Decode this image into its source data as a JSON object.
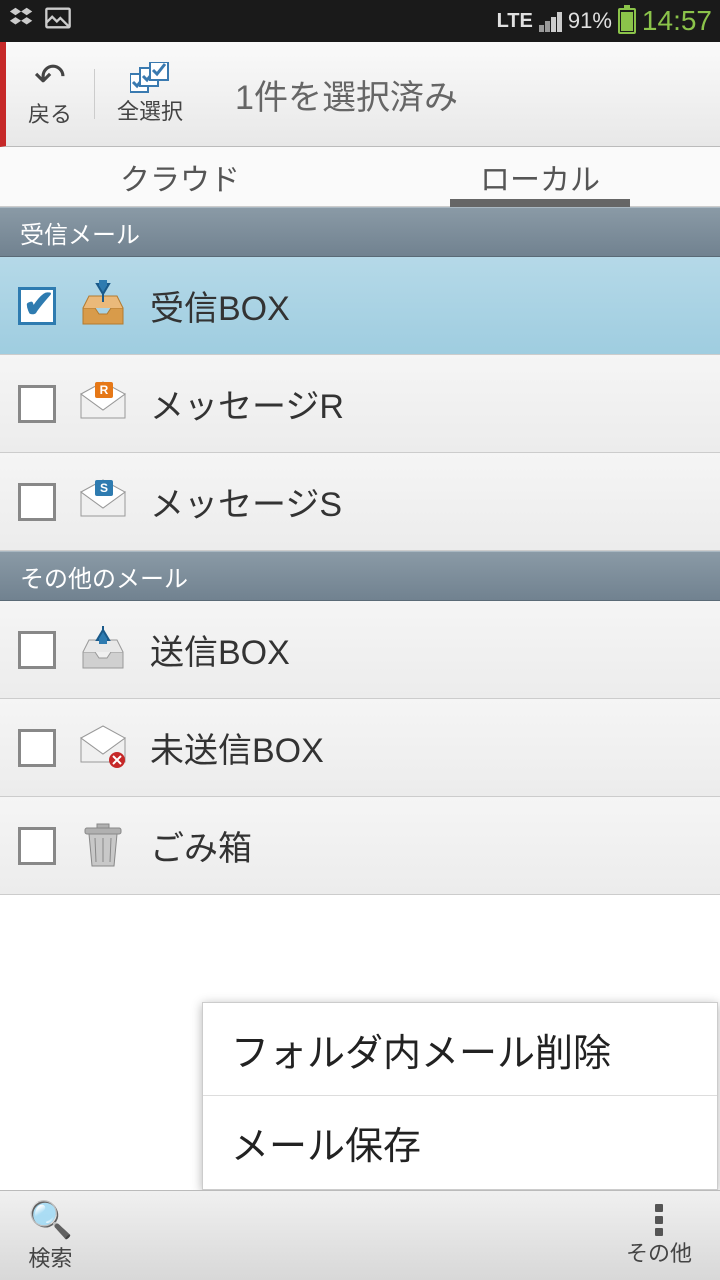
{
  "status": {
    "network": "LTE",
    "battery_pct": "91%",
    "time": "14:57"
  },
  "action_bar": {
    "back_label": "戻る",
    "select_all_label": "全選択",
    "title": "1件を選択済み"
  },
  "tabs": {
    "cloud": "クラウド",
    "local": "ローカル"
  },
  "sections": [
    {
      "header": "受信メール",
      "folders": [
        {
          "label": "受信BOX",
          "checked": true,
          "icon": "inbox-icon"
        },
        {
          "label": "メッセージR",
          "checked": false,
          "icon": "message-r-icon"
        },
        {
          "label": "メッセージS",
          "checked": false,
          "icon": "message-s-icon"
        }
      ]
    },
    {
      "header": "その他のメール",
      "folders": [
        {
          "label": "送信BOX",
          "checked": false,
          "icon": "outbox-icon"
        },
        {
          "label": "未送信BOX",
          "checked": false,
          "icon": "unsent-icon"
        },
        {
          "label": "ごみ箱",
          "checked": false,
          "icon": "trash-icon"
        }
      ]
    }
  ],
  "popup": {
    "delete_mail": "フォルダ内メール削除",
    "save_mail": "メール保存"
  },
  "bottom": {
    "search": "検索",
    "other": "その他"
  }
}
